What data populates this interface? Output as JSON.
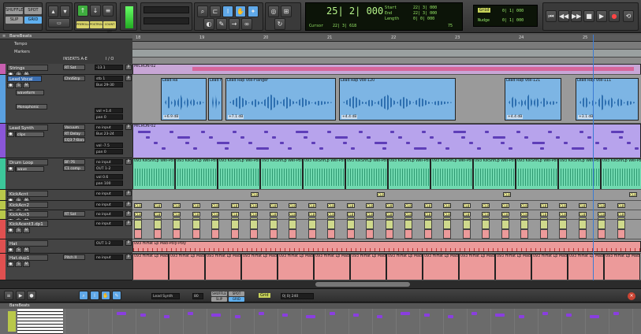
{
  "toolbar": {
    "modes": {
      "shuffle": "SHUFFLE",
      "spot": "SPOT",
      "slip": "SLIP",
      "grid": "GRID"
    },
    "track_btns": {
      "preroll": "PREROLL",
      "postroll": "POSTROLL",
      "countoff": "COUNT OFF"
    },
    "counter": {
      "main": "25| 2| 000",
      "start_label": "Start",
      "end_label": "End",
      "length_label": "Length",
      "start": "22| 3| 000",
      "end": "22| 3| 000",
      "length": "0| 0| 000",
      "cursor_label": "Cursor",
      "cursor": "22| 3| 618",
      "tempo": "75"
    },
    "grid": {
      "label": "Grid",
      "value": "0| 1| 000",
      "nudge_label": "Nudge",
      "nudge_value": "0| 1| 000"
    }
  },
  "session": {
    "title": "BareBeats"
  },
  "rulers": {
    "tempo": "Tempo",
    "markers": "Markers"
  },
  "columns": {
    "inserts": "INSERTS A-E",
    "io": "I / O"
  },
  "bars": [
    "18",
    "19",
    "20",
    "21",
    "22",
    "23",
    "24",
    "25"
  ],
  "tracks": [
    {
      "name": "Strings",
      "color": "#c85fb0",
      "ins": "RT Sat",
      "io": "-13.1"
    },
    {
      "name": "Lead Vocal",
      "color": "#5aa0e0",
      "ins": "ChnlStrp",
      "io": "stb 1",
      "io2": "Bus 29-30",
      "view": "waveform",
      "mode": "Monophonic",
      "vol": "+1.4",
      "pan": "0"
    },
    {
      "name": "Lead Synth",
      "color": "#8a56d8",
      "ins": "Vacuum",
      "ins2": "RT Delay",
      "ins3": "EQ3 7-Band",
      "io": "no input",
      "io2": "Bus 23-24",
      "view": "clips",
      "vol": "-7.5",
      "pan": "0"
    },
    {
      "name": "Drum Loop",
      "color": "#3cc79a",
      "ins": "BF-76",
      "ins2": "C1 comp",
      "io": "no input",
      "io2": "OUT 1-2",
      "view": "wave",
      "vol": "0.6",
      "pan": "100"
    },
    {
      "name": "KickAcnt",
      "color": "#b9c84a",
      "io": "no input"
    },
    {
      "name": "KickAcn2",
      "color": "#b9c84a",
      "io": "no input"
    },
    {
      "name": "KickAcn3",
      "color": "#b9c84a",
      "ins": "RT Sat",
      "io": "no input"
    },
    {
      "name": "KickAcent3.dp1",
      "color": "#e05050",
      "io": "no input"
    },
    {
      "name": "Hat",
      "color": "#e05050",
      "io": "OUT 1-2"
    },
    {
      "name": "Hat.dup1",
      "color": "#e05050",
      "ins": "Pitch II",
      "io": "no input"
    }
  ],
  "clips": {
    "strings": "MICRON-02",
    "vocal": [
      {
        "name": "Lead Ra",
        "db": "+6.9 dB"
      },
      {
        "name": "Lead F"
      },
      {
        "name": "Lead Rap Vox-Flanger",
        "db": "+7.1 dB"
      },
      {
        "name": "Lead Rap Vox-120",
        "db": "+4.4 dB"
      },
      {
        "name": "Lead Rap Vox-121",
        "db": "+4.4 dB"
      },
      {
        "name": "Lead Rap Vox-111",
        "db": "+3.1 dB"
      }
    ],
    "synth": "MICRON-02",
    "drums": "093 KikSnrLp Wel-Poly-Poly",
    "hat": "093 HiHat Lp Mad-Poly-Poly",
    "hat2": "093 HiHat Lp Mad-Poly-Poly",
    "clb": "CL8"
  },
  "bottom": {
    "track": "Lead Synth",
    "value": "80",
    "grid": "Grid",
    "grid_value": "0| 0| 240",
    "shuffle": "SHUFFLE",
    "spot": "SPOT",
    "slip": "SLIP",
    "grid_mode": "GRID",
    "title": "BareBeats"
  },
  "colors": {
    "vocal": "#5aa0e0",
    "synth": "#b7a3ec",
    "drum": "#71d9b0",
    "kick": "#cfd98c",
    "hat": "#ec9a9a"
  }
}
